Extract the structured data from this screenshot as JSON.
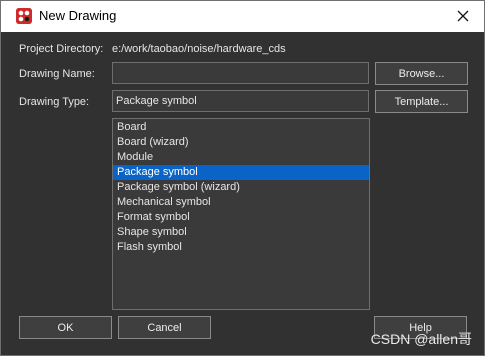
{
  "window": {
    "title": "New Drawing"
  },
  "form": {
    "project_dir_label": "Project Directory:",
    "project_dir_value": "e:/work/taobao/noise/hardware_cds",
    "drawing_name_label": "Drawing Name:",
    "drawing_name_value": "",
    "browse_label": "Browse...",
    "drawing_type_label": "Drawing Type:",
    "drawing_type_value": "Package symbol",
    "template_label": "Template..."
  },
  "types": {
    "items": [
      "Board",
      "Board (wizard)",
      "Module",
      "Package symbol",
      "Package symbol (wizard)",
      "Mechanical symbol",
      "Format symbol",
      "Shape symbol",
      "Flash symbol"
    ],
    "selected": "Package symbol"
  },
  "footer": {
    "ok_label": "OK",
    "cancel_label": "Cancel",
    "help_label": "Help"
  },
  "watermark": "CSDN @allen哥",
  "colors": {
    "dialog_bg": "#313131",
    "selection": "#0a64c8",
    "app_icon": "#cf2b2b"
  },
  "icons": {
    "app": "allegro-app-icon",
    "close": "close-icon"
  }
}
